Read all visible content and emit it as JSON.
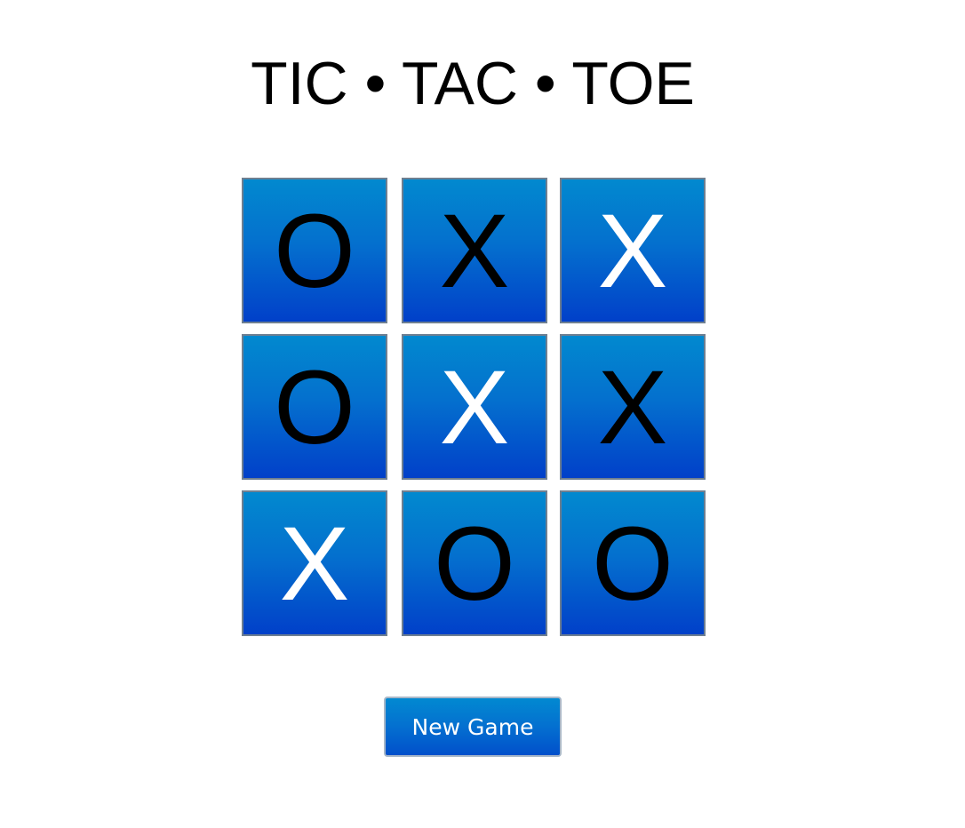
{
  "title": "TIC • TAC • TOE",
  "board": {
    "cells": [
      {
        "mark": "O",
        "tone": "dark"
      },
      {
        "mark": "X",
        "tone": "dark"
      },
      {
        "mark": "X",
        "tone": "light"
      },
      {
        "mark": "O",
        "tone": "dark"
      },
      {
        "mark": "X",
        "tone": "light"
      },
      {
        "mark": "X",
        "tone": "dark"
      },
      {
        "mark": "X",
        "tone": "light"
      },
      {
        "mark": "O",
        "tone": "dark"
      },
      {
        "mark": "O",
        "tone": "dark"
      }
    ]
  },
  "controls": {
    "new_game_label": "New Game"
  },
  "colors": {
    "cell_gradient_top": "#0289cf",
    "cell_gradient_bottom": "#0140c9",
    "cell_border": "#6e7f91",
    "mark_dark": "#000000",
    "mark_light": "#ffffff",
    "background": "#ffffff"
  }
}
